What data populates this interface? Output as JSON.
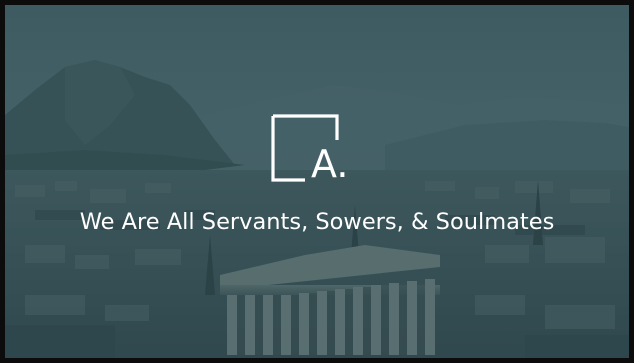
{
  "slide": {
    "logo_letter": "A.",
    "title": "We Are All Servants, Sowers, & Soulmates"
  },
  "colors": {
    "overlay_tint": "#2c4a52",
    "text": "#ffffff",
    "frame": "#0c0c0c"
  },
  "icons": {
    "logo": "corner-bracket-logo-icon"
  }
}
